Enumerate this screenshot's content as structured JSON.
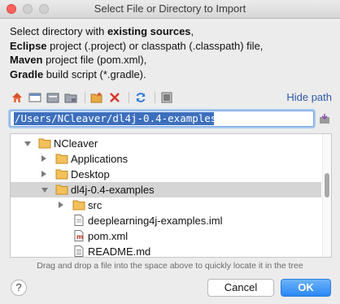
{
  "window": {
    "title": "Select File or Directory to Import"
  },
  "description": {
    "line1_pre": "Select directory with ",
    "line1_bold": "existing sources",
    "line1_post": ",",
    "line2_bold": "Eclipse",
    "line2_post": " project (.project) or classpath (.classpath) file,",
    "line3_bold": "Maven",
    "line3_post": " project file (pom.xml),",
    "line4_bold": "Gradle",
    "line4_post": " build script (*.gradle)."
  },
  "toolbar": {
    "icons": [
      "home-icon",
      "desktop-icon",
      "project-folder-icon",
      "module-folder-icon",
      "new-folder-icon",
      "delete-icon",
      "refresh-icon",
      "show-hidden-icon"
    ],
    "hide_path_label": "Hide path"
  },
  "path": {
    "value": "/Users/NCleaver/dl4j-0.4-examples"
  },
  "tree": {
    "rows": [
      {
        "label": "NCleaver",
        "type": "folder",
        "expanded": true,
        "depth": 0
      },
      {
        "label": "Applications",
        "type": "folder",
        "expanded": false,
        "depth": 1
      },
      {
        "label": "Desktop",
        "type": "folder",
        "expanded": false,
        "depth": 1
      },
      {
        "label": "dl4j-0.4-examples",
        "type": "folder",
        "expanded": true,
        "depth": 1,
        "selected": true
      },
      {
        "label": "src",
        "type": "folder",
        "expanded": false,
        "depth": 2
      },
      {
        "label": "deeplearning4j-examples.iml",
        "type": "iml-file",
        "depth": 2
      },
      {
        "label": "pom.xml",
        "type": "maven-file",
        "depth": 2
      },
      {
        "label": "README.md",
        "type": "text-file",
        "depth": 2
      }
    ]
  },
  "hint": "Drag and drop a file into the space above to quickly locate it in the tree",
  "buttons": {
    "help": "?",
    "cancel": "Cancel",
    "ok": "OK"
  },
  "colors": {
    "ok_button": "#2a87f3",
    "link": "#2d5ca8",
    "selection": "#3d6fbd",
    "folder": "#e7a943"
  }
}
